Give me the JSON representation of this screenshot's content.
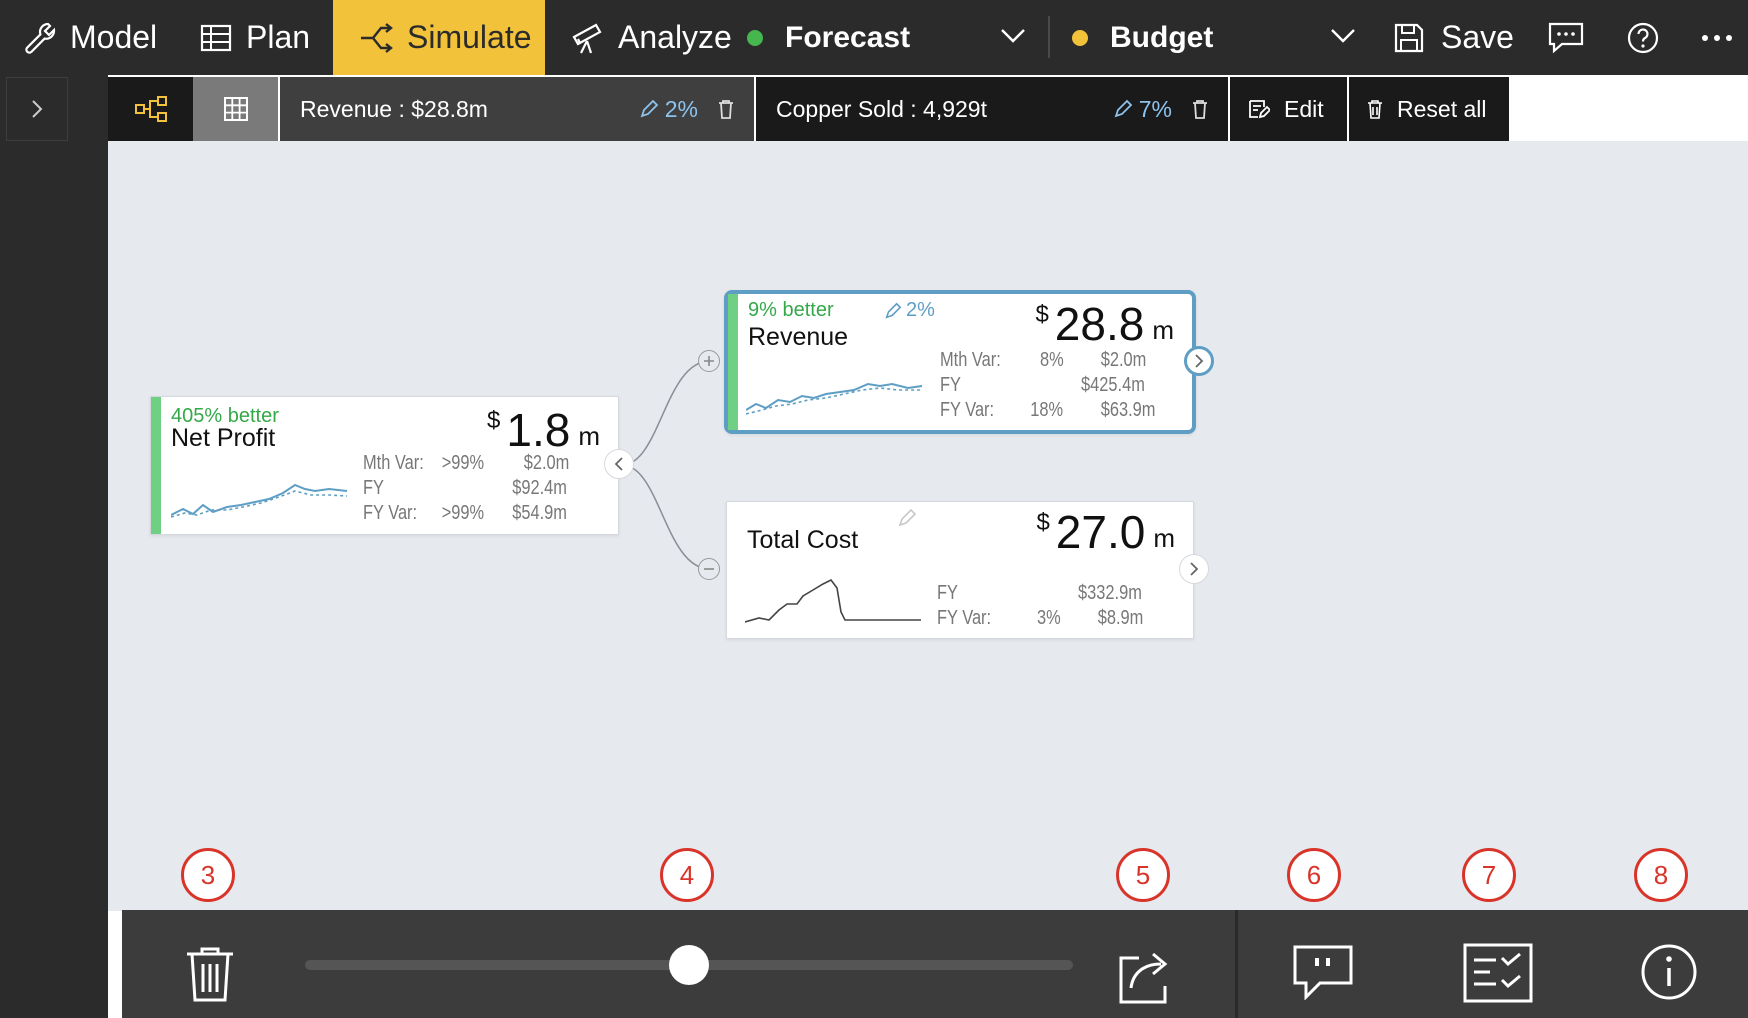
{
  "topbar": {
    "model": "Model",
    "plan": "Plan",
    "simulate": "Simulate",
    "analyze": "Analyze",
    "forecast": "Forecast",
    "forecast_color": "#46b64f",
    "budget": "Budget",
    "budget_color": "#f2c23a",
    "save": "Save",
    "active_tab": "Simulate"
  },
  "filterbar": {
    "revenue_label": "Revenue : $28.8m",
    "revenue_pct": "2%",
    "copper_label": "Copper Sold : 4,929t",
    "copper_pct": "7%",
    "edit": "Edit",
    "reset_all": "Reset all"
  },
  "cards": {
    "net_profit": {
      "better": "405% better",
      "name": "Net Profit",
      "currency": "$",
      "value": "1.8",
      "unit": "m",
      "rows": [
        {
          "label": "Mth Var:",
          "pct": ">99%",
          "amount": "$2.0m"
        },
        {
          "label": "FY",
          "pct": "",
          "amount": "$92.4m"
        },
        {
          "label": "FY Var:",
          "pct": ">99%",
          "amount": "$54.9m"
        }
      ]
    },
    "revenue": {
      "better": "9% better",
      "edit_pct": "2%",
      "name": "Revenue",
      "currency": "$",
      "value": "28.8",
      "unit": "m",
      "rows": [
        {
          "label": "Mth Var:",
          "pct": "8%",
          "amount": "$2.0m"
        },
        {
          "label": "FY",
          "pct": "",
          "amount": "$425.4m"
        },
        {
          "label": "FY Var:",
          "pct": "18%",
          "amount": "$63.9m"
        }
      ]
    },
    "total_cost": {
      "name": "Total Cost",
      "currency": "$",
      "value": "27.0",
      "unit": "m",
      "rows": [
        {
          "label": "FY",
          "pct": "",
          "amount": "$332.9m"
        },
        {
          "label": "FY Var:",
          "pct": "3%",
          "amount": "$8.9m"
        }
      ]
    }
  },
  "annotations": [
    "3",
    "4",
    "5",
    "6",
    "7",
    "8"
  ],
  "bottombar": {
    "slider_value_fraction": 0.5
  },
  "colors": {
    "accent": "#f2c23a",
    "better_green": "#35a84a",
    "selected_border": "#5e9ec5",
    "annotation_red": "#d8342a"
  }
}
